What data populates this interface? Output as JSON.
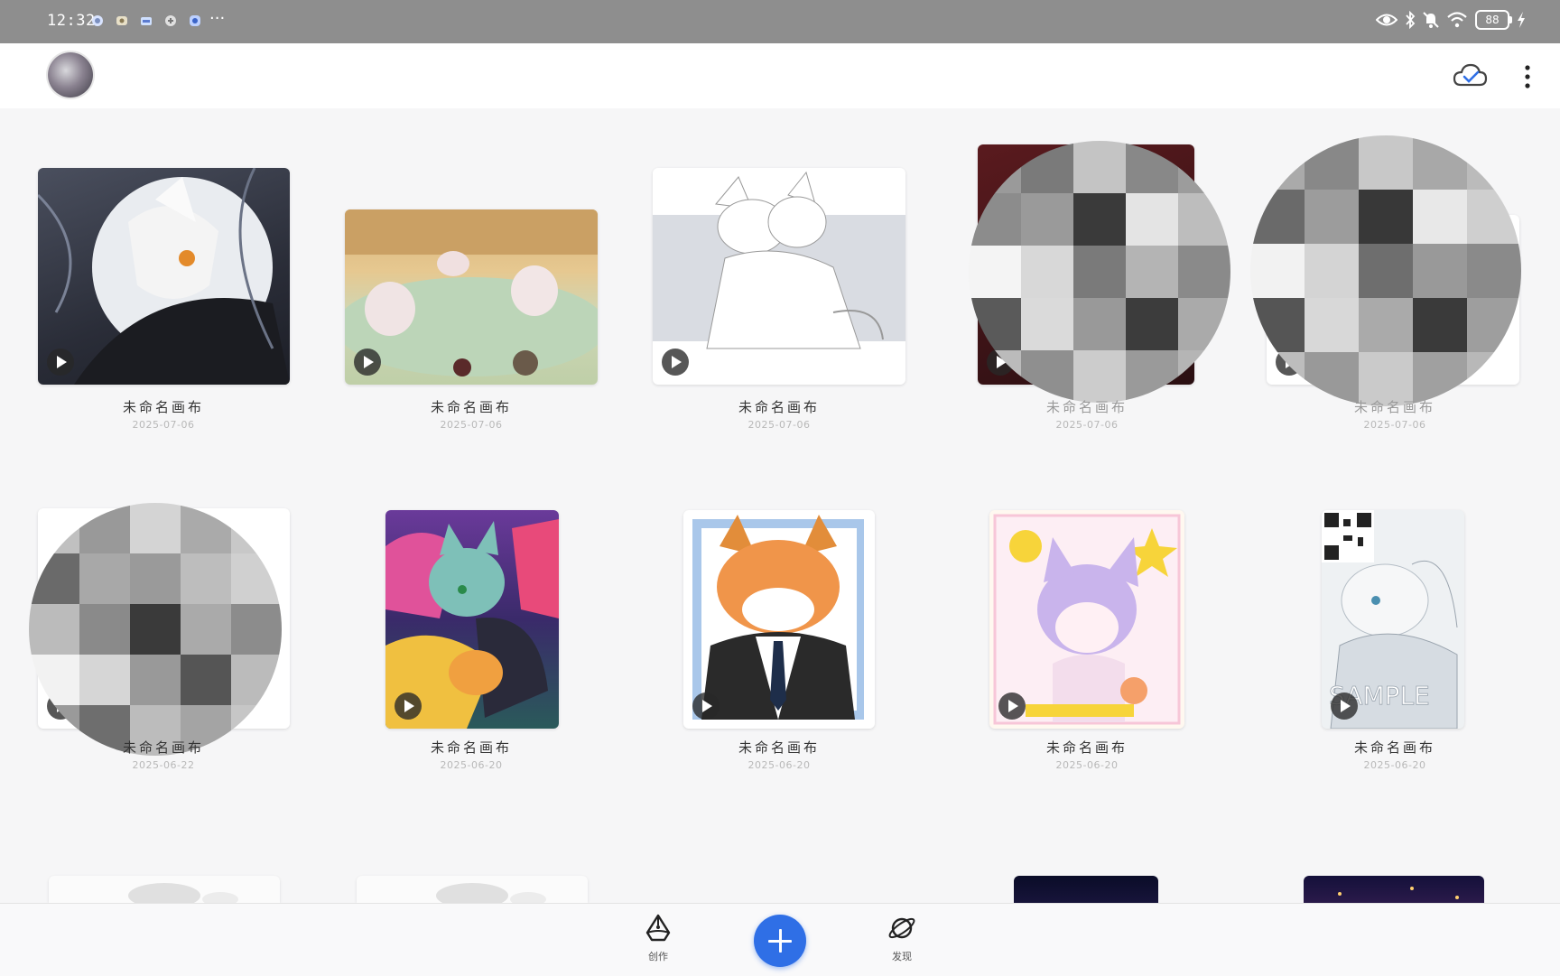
{
  "status_bar": {
    "time": "12:32",
    "more": "···",
    "battery": "88",
    "icons": [
      "eye-icon",
      "bluetooth-icon",
      "mute-icon",
      "wifi-icon",
      "battery-icon",
      "charging-icon"
    ],
    "notification_icons": [
      "notif-app-1-icon",
      "notif-app-2-icon",
      "notif-app-3-icon",
      "notif-app-4-icon",
      "notif-app-5-icon"
    ]
  },
  "header": {
    "avatar": "avatar",
    "cloud_icon": "cloud-sync-icon",
    "menu_icon": "more-vertical-icon"
  },
  "artworks": [
    {
      "name": "未命名画布",
      "date": "2025-07-06",
      "style": "moon-dark",
      "censored": false
    },
    {
      "name": "未命名画布",
      "date": "2025-07-06",
      "style": "onsen",
      "censored": false
    },
    {
      "name": "未命名画布",
      "date": "2025-07-06",
      "style": "white-sketch",
      "censored": false
    },
    {
      "name": "未命名画布",
      "date": "2025-07-06",
      "style": "dark-red",
      "censored": true
    },
    {
      "name": "未命名画布",
      "date": "2025-07-06",
      "style": "light",
      "censored": true
    },
    {
      "name": "未命名画布",
      "date": "2025-06-22",
      "style": "light",
      "censored": true
    },
    {
      "name": "未命名画布",
      "date": "2025-06-20",
      "style": "graffiti",
      "censored": false
    },
    {
      "name": "未命名画布",
      "date": "2025-06-20",
      "style": "office-fox",
      "censored": false
    },
    {
      "name": "未命名画布",
      "date": "2025-06-20",
      "style": "pastel",
      "censored": false
    },
    {
      "name": "未命名画布",
      "date": "2025-06-20",
      "style": "sample",
      "censored": false
    }
  ],
  "bottom_nav": {
    "create_label": "创作",
    "discover_label": "发现",
    "add_button": "add-icon"
  },
  "colors": {
    "accent": "#2f6fe6",
    "status_bar": "#8e8e8e",
    "background": "#f6f6f7"
  }
}
